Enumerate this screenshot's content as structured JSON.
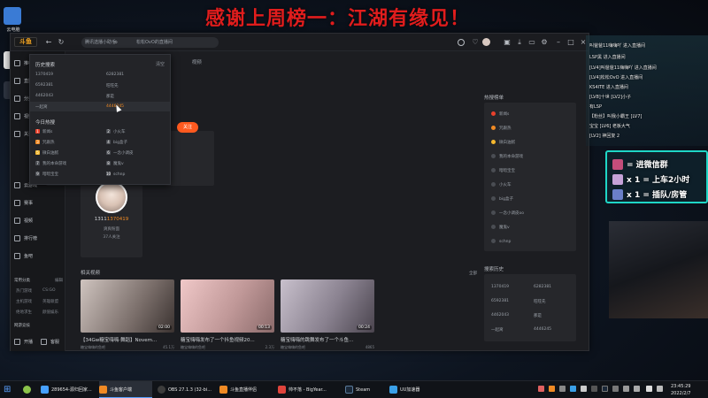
{
  "banner": "感谢上周榜一：江湖有缘见！",
  "desktop": {
    "icons": [
      {
        "label": "云电脑",
        "color": "#3a7bd5"
      },
      {
        "label": "",
        "color": "#ffffff"
      },
      {
        "label": "",
        "color": "#2e3440"
      }
    ]
  },
  "window": {
    "logo_text": "斗鱼",
    "search_value": "腾讯选播小助手",
    "search_hint": "松松OvO的直播间",
    "nav_back": "←",
    "nav_forward": "→",
    "nav_refresh": "↻",
    "search_icon": "⌕",
    "title_icons": [
      "clock-icon",
      "heart-icon",
      "avatar-icon",
      "gift-icon",
      "download-icon",
      "message-icon",
      "settings-icon",
      "minimize-icon",
      "maximize-icon",
      "close-icon"
    ]
  },
  "sidebar": {
    "items": [
      {
        "label": "推荐",
        "icon": "home-icon"
      },
      {
        "label": "直播",
        "icon": "live-icon"
      },
      {
        "label": "分类",
        "icon": "category-icon"
      },
      {
        "label": "视频",
        "icon": "video-icon"
      },
      {
        "label": "关注",
        "icon": "follow-icon"
      },
      {
        "label": "云游戏",
        "icon": "cloud-game-icon"
      },
      {
        "label": "赛事",
        "icon": "match-icon"
      },
      {
        "label": "视频",
        "icon": "film-icon"
      },
      {
        "label": "排行榜",
        "icon": "rank-icon"
      },
      {
        "label": "鱼吧",
        "icon": "fish-icon"
      }
    ],
    "common_title": "常用分类",
    "common_edit": "编辑",
    "common_items": [
      "热门游戏",
      "CS:GO",
      "主机游戏",
      "英雄联盟",
      "绝地求生",
      "颜值娱乐"
    ],
    "recent_title": "网游竞技",
    "bottom": [
      {
        "label": "开播",
        "icon": "broadcast-icon"
      },
      {
        "label": "客服",
        "icon": "service-icon"
      }
    ]
  },
  "tabs": [
    "全部",
    "视频"
  ],
  "dropdown": {
    "history_title": "历史搜索",
    "clear_label": "清空",
    "history": [
      "1370419",
      "6282381",
      "6592381",
      "旺旺先",
      "4462043",
      "那是",
      "一起窝",
      "4446245"
    ],
    "hot_title": "今日热搜",
    "hot": [
      {
        "rank": "1",
        "text": "新闻s",
        "color": "#e8412c"
      },
      {
        "rank": "2",
        "text": "小火车",
        "color": "#7a7f87"
      },
      {
        "rank": "3",
        "text": "咒跟热",
        "color": "#f08a24"
      },
      {
        "rank": "4",
        "text": "big盒子",
        "color": "#7a7f87"
      },
      {
        "rank": "5",
        "text": "微白油腻",
        "color": "#f5b82e"
      },
      {
        "rank": "6",
        "text": "一念小调皮",
        "color": "#7a7f87"
      },
      {
        "rank": "7",
        "text": "我的本命游戏",
        "color": "#7a7f87"
      },
      {
        "rank": "8",
        "text": "魔鬼v",
        "color": "#7a7f87"
      },
      {
        "rank": "9",
        "text": "暗暗宝宝",
        "color": "#7a7f87"
      },
      {
        "rank": "10",
        "text": "schnp",
        "color": "#7a7f87"
      }
    ]
  },
  "follow_button": "关注",
  "streamer": {
    "id_prefix": "1311",
    "id_highlight": "1370419",
    "name": "爽爽粉面",
    "fans": "37人关注"
  },
  "related": {
    "title": "相关视频",
    "all_label": "全部",
    "videos": [
      {
        "title": "【34Gw糖宝嗨嗨·舞蹈】Novem...",
        "duration": "02:00",
        "author": "糖宝嗨嗨的鱼吧",
        "views": "45.1万",
        "tint": "#b8a8a4"
      },
      {
        "title": "糖宝嗨嗨发布了一个抖鱼视频20...",
        "duration": "00:13",
        "author": "糖宝嗨嗨的鱼吧",
        "views": "2.3万",
        "tint": "#d4a8a8"
      },
      {
        "title": "糖宝嗨嗨的跳舞发布了一个斗鱼...",
        "duration": "00:24",
        "author": "糖宝嗨嗨的鱼吧",
        "views": "4865",
        "tint": "#a8a0b0"
      }
    ]
  },
  "right_hot": {
    "title": "热搜榜单",
    "items": [
      {
        "text": "新闻s",
        "color": "#e8412c"
      },
      {
        "text": "咒跟热",
        "color": "#f08a24"
      },
      {
        "text": "微白油腻",
        "color": "#f5b82e"
      },
      {
        "text": "我的本命游戏",
        "color": "#4a4d53"
      },
      {
        "text": "暗暗宝宝",
        "color": "#4a4d53"
      },
      {
        "text": "小火车",
        "color": "#4a4d53"
      },
      {
        "text": "big盒子",
        "color": "#4a4d53"
      },
      {
        "text": "一念小调皮oo",
        "color": "#4a4d53"
      },
      {
        "text": "魔鬼v",
        "color": "#4a4d53"
      },
      {
        "text": "schnp",
        "color": "#4a4d53"
      }
    ]
  },
  "right_history": {
    "title": "搜索历史",
    "items": [
      "1370419",
      "6282381",
      "6592381",
      "旺旺先",
      "4462043",
      "那是",
      "一起窝",
      "4446245"
    ]
  },
  "chat": {
    "lines": [
      {
        "lv": "",
        "text": "叫爸爸11嗨嗨吖 进入直播间"
      },
      {
        "lv": "",
        "text": "LSP黑 进入直播间"
      },
      {
        "lv": "",
        "text": "[LV4]叫爸爸11嗨嗨吖 进入直播间"
      },
      {
        "lv": "",
        "text": "[LV4]松松OvO 进入直播间"
      },
      {
        "lv": "",
        "text": "KS4ITE 进入直播间"
      },
      {
        "lv": "",
        "text": "[LV8]十世 [LV2]小子"
      },
      {
        "lv": "",
        "text": "有LSP"
      },
      {
        "lv": "",
        "text": "【粉丝】叫我小霸王 [LV7]"
      },
      {
        "lv": "",
        "text": "宝宝 [LV6] 老板大气"
      },
      {
        "lv": "",
        "text": "[LV2] 神回复 2"
      }
    ]
  },
  "promo": {
    "lines": [
      "= 进微信群",
      "x 1 = 上车2小时",
      "x 1 = 插队/房管"
    ],
    "icon_colors": [
      "#c44d7a",
      "#c6a2d8",
      "#6a7fc8"
    ]
  },
  "taskbar": {
    "items": [
      {
        "label": "289654-源归回家...",
        "color": "#46a0ff",
        "active": false
      },
      {
        "label": "斗鱼客户端",
        "color": "#f08a24",
        "active": true
      },
      {
        "label": "OBS 27.1.3 (32-bi...",
        "color": "#3c3c3c",
        "active": false
      },
      {
        "label": "斗鱼直播伴侣",
        "color": "#f08a24",
        "active": false
      },
      {
        "label": "帅不落 - BigYear...",
        "color": "#e0443c",
        "active": false
      },
      {
        "label": "Steam",
        "color": "#1b2838",
        "active": false
      },
      {
        "label": "UU加速器",
        "color": "#3aa0e8",
        "active": false
      }
    ],
    "time": "23:45:29",
    "date": "2022/2/7"
  }
}
